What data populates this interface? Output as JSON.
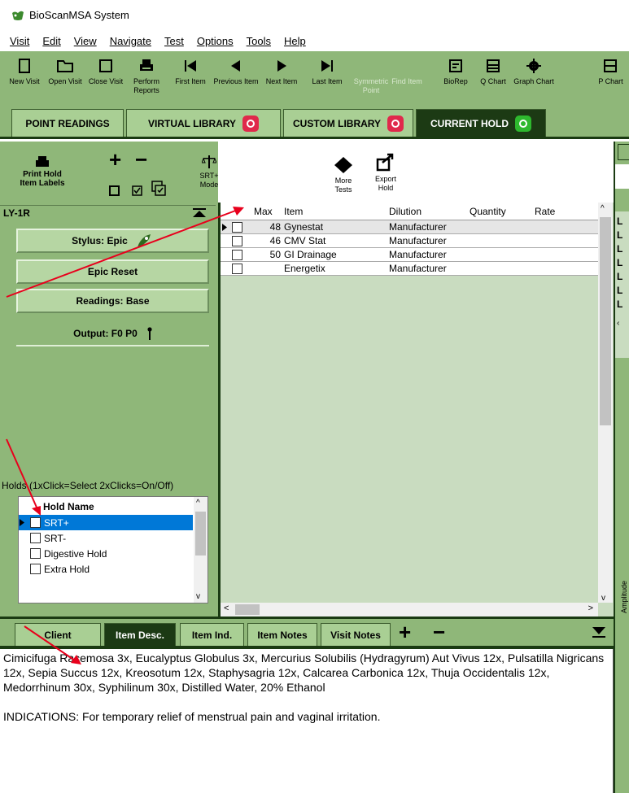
{
  "window": {
    "title": "BioScanMSA System"
  },
  "menu": [
    "Visit",
    "Edit",
    "View",
    "Navigate",
    "Test",
    "Options",
    "Tools",
    "Help"
  ],
  "toolbar": [
    {
      "label": "New Visit",
      "icon": "new-doc-icon"
    },
    {
      "label": "Open Visit",
      "icon": "folder-open-icon"
    },
    {
      "label": "Close Visit",
      "icon": "close-window-icon"
    },
    {
      "label": "Perform Reports",
      "icon": "printer-icon"
    },
    {
      "label": "First Item",
      "icon": "first-item-icon"
    },
    {
      "label": "Previous Item",
      "icon": "previous-item-icon"
    },
    {
      "label": "Next Item",
      "icon": "next-item-icon"
    },
    {
      "label": "Last Item",
      "icon": "last-item-icon"
    },
    {
      "label": "Symmetric Point",
      "icon": "symmetric-point-icon",
      "disabled": true
    },
    {
      "label": "Find Item",
      "icon": "find-item-icon",
      "disabled": true
    },
    {
      "label": "BioRep",
      "icon": "biorep-icon"
    },
    {
      "label": "Q Chart",
      "icon": "q-chart-icon"
    },
    {
      "label": "Graph Chart",
      "icon": "gear-icon"
    },
    {
      "label": "P Chart",
      "icon": "p-chart-icon"
    }
  ],
  "tabs": [
    {
      "label": "POINT READINGS"
    },
    {
      "label": "VIRTUAL LIBRARY"
    },
    {
      "label": "CUSTOM LIBRARY"
    },
    {
      "label": "CURRENT HOLD",
      "active": true
    }
  ],
  "hold_toolbar": {
    "print_label": "Print Hold Item Labels",
    "srt_label": "SRT+ Mode",
    "more_tests_label": "More Tests",
    "export_label": "Export Hold"
  },
  "panel": {
    "location": "LY-1R",
    "stylus": "Stylus: Epic",
    "epic_reset": "Epic Reset",
    "readings": "Readings: Base",
    "output": "Output: F0 P0",
    "holds_caption": "Holds (1xClick=Select  2xClicks=On/Off)",
    "holds_header": "Hold Name",
    "holds": [
      "SRT+",
      "SRT-",
      "Digestive Hold",
      "Extra Hold"
    ]
  },
  "grid": {
    "columns": [
      "Max",
      "Item",
      "Dilution",
      "Quantity",
      "Rate"
    ],
    "rows": [
      {
        "max": "48",
        "item": "Gynestat",
        "dilution": "Manufacturer"
      },
      {
        "max": "46",
        "item": "CMV Stat",
        "dilution": "Manufacturer"
      },
      {
        "max": "50",
        "item": "GI Drainage",
        "dilution": "Manufacturer"
      },
      {
        "max": "",
        "item": "Energetix",
        "dilution": "Manufacturer"
      }
    ]
  },
  "right_strip": {
    "letters": [
      "L",
      "L",
      "L",
      "L",
      "L",
      "L",
      "L"
    ],
    "vertical_label": "Amplitude"
  },
  "bottom_tabs": [
    {
      "label": "Client"
    },
    {
      "label": "Item Desc.",
      "active": true
    },
    {
      "label": "Item Ind."
    },
    {
      "label": "Item Notes"
    },
    {
      "label": "Visit Notes"
    }
  ],
  "description": {
    "ingredients": "Cimicifuga Racemosa 3x, Eucalyptus Globulus 3x, Mercurius Solubilis (Hydragyrum) Aut Vivus 12x, Pulsatilla Nigricans 12x, Sepia Succus 12x, Kreosotum 12x, Staphysagria 12x, Calcarea Carbonica 12x, Thuja Occidentalis 12x, Medorrhinum 30x, Syphilinum 30x, Distilled Water, 20% Ethanol",
    "indications": "INDICATIONS: For temporary relief of menstrual pain and vaginal irritation."
  },
  "colors": {
    "panel_green": "#8fb779",
    "dark_green": "#1a3a12",
    "arrow_red": "#e8001c"
  }
}
